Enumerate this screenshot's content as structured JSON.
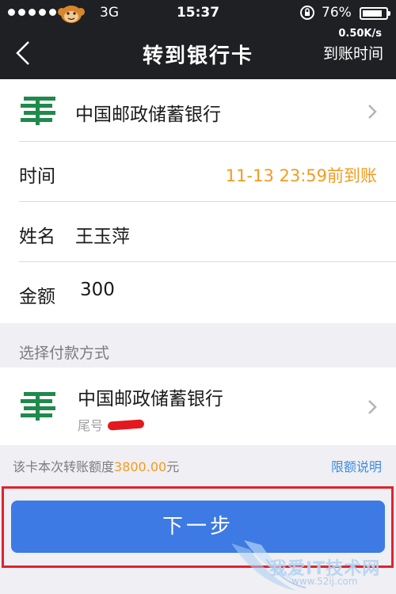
{
  "status_bar": {
    "carrier": "3G",
    "time": "15:37",
    "battery": "76%",
    "battery_level": 0.76,
    "net_speed": "0.50K/s"
  },
  "nav": {
    "title": "转到银行卡",
    "right_label": "到账时间"
  },
  "transfer": {
    "bank_name": "中国邮政储蓄银行",
    "time_label": "时间",
    "time_value": "11-13 23:59前到账",
    "name_label": "姓名",
    "name_value": "王玉萍",
    "amount_label": "金额",
    "amount_value": "300"
  },
  "payment": {
    "section_title": "选择付款方式",
    "bank_name": "中国邮政储蓄银行",
    "tail_label": "尾号"
  },
  "limit": {
    "prefix": "该卡本次转账额度",
    "amount": "3800.00",
    "suffix": "元",
    "link": "限额说明"
  },
  "next_button": "下一步",
  "watermark": {
    "text": "我爱IT技术网",
    "url": "www.52ij.com"
  },
  "colors": {
    "accent_blue": "#3d7ae3",
    "deadline_orange": "#f39b1e",
    "postal_green": "#1f8a4c",
    "highlight_red": "#e0232b"
  },
  "icons": [
    "back-icon",
    "chevron-right-icon",
    "postal-bank-logo",
    "rotation-lock-icon",
    "battery-icon"
  ]
}
